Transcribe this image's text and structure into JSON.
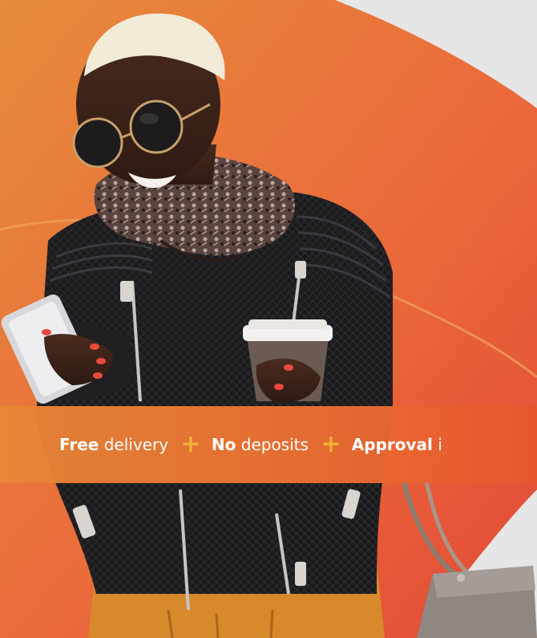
{
  "banner": {
    "items": [
      {
        "bold": "Free",
        "rest": "delivery"
      },
      {
        "bold": "No",
        "rest": "deposits"
      },
      {
        "bold": "Approval",
        "rest": "i"
      }
    ],
    "separator": "+"
  },
  "colors": {
    "orange_light": "#e98a3a",
    "orange_dark": "#e8523a",
    "banner_plus": "#f2b136",
    "grey_background": "#e6e6e6",
    "text": "#ffffff"
  },
  "photo": {
    "subject": "woman-with-smartphone-and-coffee-cup",
    "icons": [
      "smartphone-icon",
      "coffee-cup-icon",
      "handbag-icon",
      "sunglasses-icon"
    ]
  }
}
